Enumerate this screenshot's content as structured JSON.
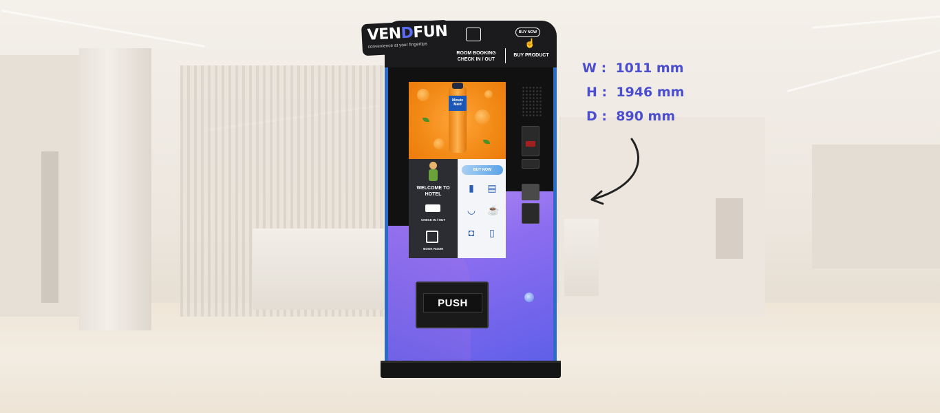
{
  "brand": {
    "name_part1": "VEN",
    "name_d": "D",
    "name_part2": "FUN",
    "tagline": "convenience at your fingertips"
  },
  "header": {
    "room_booking_line1": "ROOM BOOKING",
    "room_booking_line2": "CHECK IN / OUT",
    "buy_now_badge": "BUY NOW",
    "buy_product": "BUY PRODUCT"
  },
  "screen": {
    "promo_product_line1": "Minute",
    "promo_product_line2": "Maid",
    "welcome_line1": "WELCOME TO",
    "welcome_line2": "HOTEL",
    "check_in_out": "CHECK IN / OUT",
    "book_room": "BOOK ROOM",
    "buy_now_button": "BUY NOW",
    "menu_icons": [
      "soda-can-icon",
      "snack-bag-icon",
      "bowl-icon",
      "coffee-cup-icon",
      "drink-cup-icon",
      "toiletries-icon"
    ]
  },
  "dispenser": {
    "push_label": "PUSH"
  },
  "dimensions": [
    {
      "axis": "W",
      "sep": ":",
      "value": "1011 mm"
    },
    {
      "axis": "H",
      "sep": ":",
      "value": "1946 mm"
    },
    {
      "axis": "D",
      "sep": ":",
      "value": "890 mm"
    }
  ],
  "colors": {
    "accent_blue": "#4a4ecf",
    "machine_black": "#1b1b1d",
    "trim_blue": "#2a6cc7",
    "purple": "#8c6df0",
    "orange": "#f28a16"
  }
}
